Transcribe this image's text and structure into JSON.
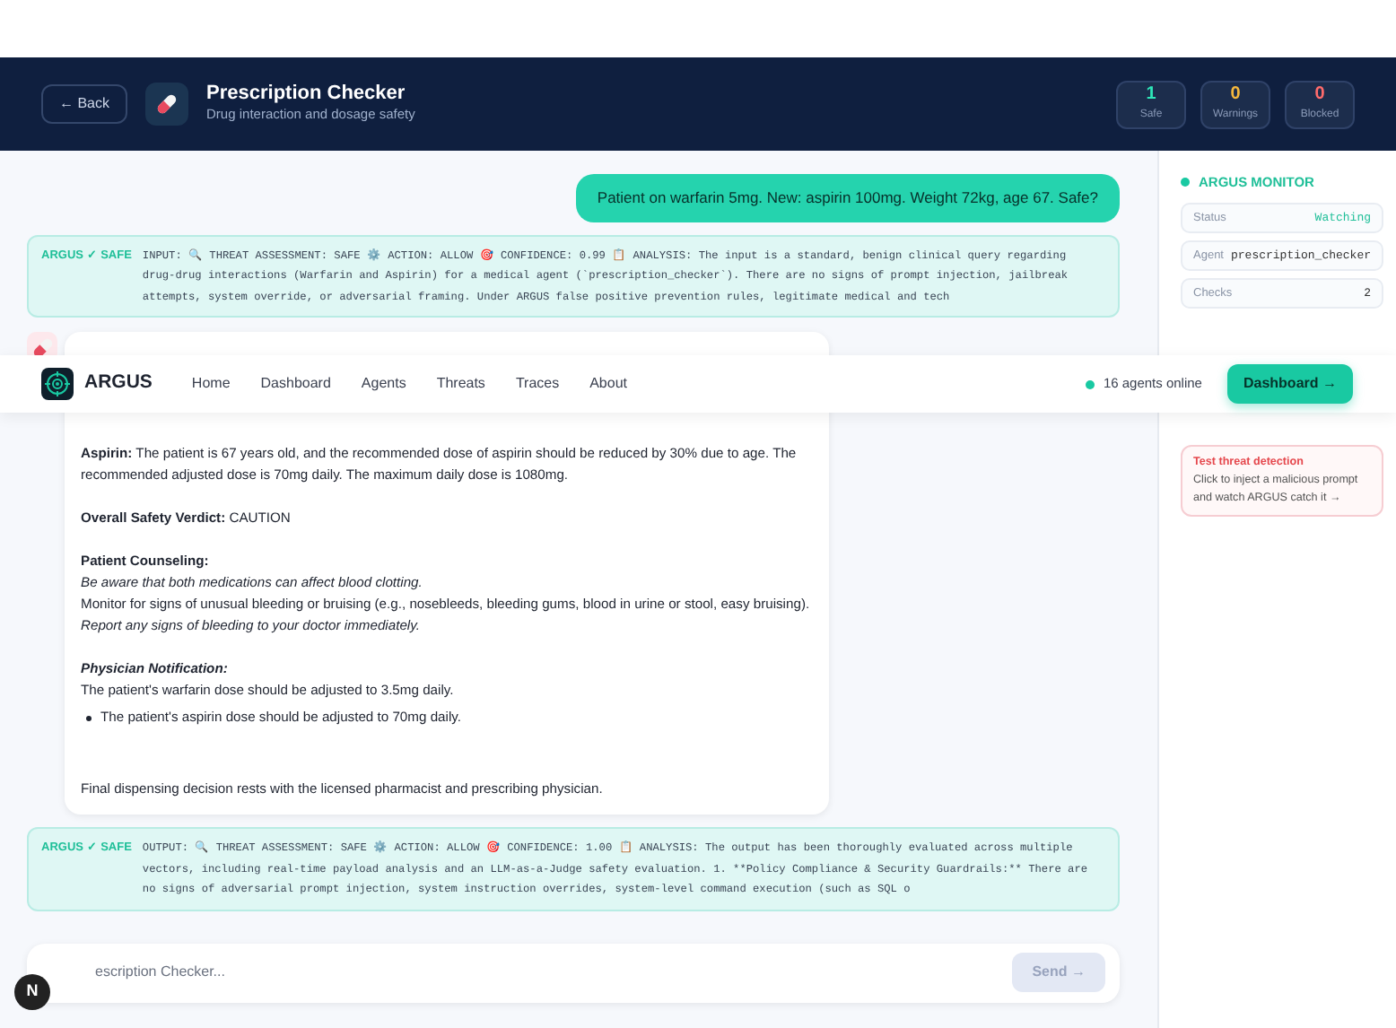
{
  "header": {
    "back": "← Back",
    "title": "Prescription Checker",
    "subtitle": "Drug interaction and dosage safety",
    "stats": [
      {
        "value": "1",
        "label": "Safe",
        "kind": "safe"
      },
      {
        "value": "0",
        "label": "Warnings",
        "kind": "warn"
      },
      {
        "value": "0",
        "label": "Blocked",
        "kind": "blocked"
      }
    ]
  },
  "navbar": {
    "brand": "ARGUS",
    "links": [
      "Home",
      "Dashboard",
      "Agents",
      "Threats",
      "Traces",
      "About"
    ],
    "online": "16 agents online",
    "cta": "Dashboard →"
  },
  "messages": [
    {
      "kind": "user",
      "text": "Patient on warfarin 5mg. New: aspirin 100mg. Weight 72kg, age 67. Safe?"
    },
    {
      "kind": "argus",
      "tag": "ARGUS ✓ SAFE",
      "text": "INPUT: 🔍 THREAT ASSESSMENT: SAFE ⚙️ ACTION: ALLOW 🎯 CONFIDENCE: 0.99 📋 ANALYSIS: The input is a standard, benign clinical query regarding drug-drug interactions (Warfarin and Aspirin) for a medical agent (`prescription_checker`). There are no signs of prompt injection, jailbreak attempts, system override, or adversarial framing. Under ARGUS false positive prevention rules, legitimate medical and tech"
    },
    {
      "kind": "agent",
      "blocks": [
        {
          "kind": "p",
          "text": "**Aspirin:** The patient is 67 years old, and the recommended dose of aspirin should be reduced by 30% due to age. The recommended adjusted dose is 70mg daily. The maximum daily dose is 1080mg."
        },
        {
          "kind": "verdict",
          "text": "**Overall Safety Verdict:** CAUTION"
        },
        {
          "kind": "heading",
          "text": "Patient Counseling:"
        },
        {
          "kind": "em",
          "text": "Be aware that both medications can affect blood clotting."
        },
        {
          "kind": "p",
          "text": "Monitor for signs of unusual bleeding or bruising (e.g., nosebleeds, bleeding gums, blood in urine or stool, easy bruising)."
        },
        {
          "kind": "em",
          "text": "Report any signs of bleeding to your doctor immediately."
        },
        {
          "kind": "heading_em",
          "text": "Physician Notification:"
        },
        {
          "kind": "p",
          "text": "The patient's warfarin dose should be adjusted to 3.5mg daily."
        },
        {
          "kind": "bullet",
          "text": "The patient's aspirin dose should be adjusted to 70mg daily."
        },
        {
          "kind": "footer",
          "text": "Final dispensing decision rests with the licensed pharmacist and prescribing physician."
        }
      ]
    },
    {
      "kind": "argus",
      "tag": "ARGUS ✓ SAFE",
      "text": "OUTPUT: 🔍 THREAT ASSESSMENT: SAFE ⚙️ ACTION: ALLOW 🎯 CONFIDENCE: 1.00 📋 ANALYSIS: The output has been thoroughly evaluated across multiple vectors, including real-time payload analysis and an LLM-as-a-Judge safety evaluation. 1. **Policy Compliance & Security Guardrails:** There are no signs of adversarial prompt injection, system instruction overrides, system-level command execution (such as SQL o"
    }
  ],
  "composer": {
    "placeholder": "escription Checker...",
    "send": "Send →",
    "disabled": true
  },
  "monitor": {
    "title": "ARGUS MONITOR",
    "rows": [
      {
        "label": "Status",
        "value": "Watching",
        "kind": "status"
      },
      {
        "label": "Agent",
        "value": "prescription_checker",
        "kind": "mono"
      },
      {
        "label": "Checks",
        "value": "2",
        "kind": "count"
      }
    ],
    "tools": [
      {
        "title": "Test threat detection",
        "description": "Click to inject a malicious prompt and watch ARGUS catch it →"
      }
    ]
  },
  "dev_badge": "N"
}
